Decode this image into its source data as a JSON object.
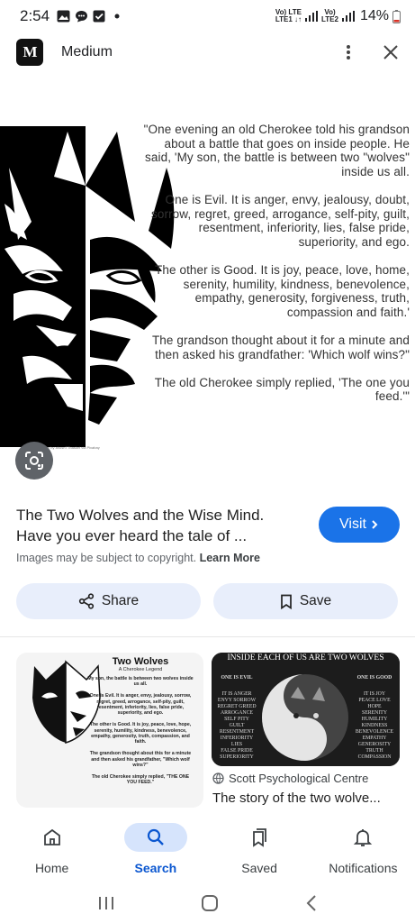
{
  "status_bar": {
    "time": "2:54",
    "net1": "Vo) LTE\nLTE1 ↓↑",
    "net2": "Vo)\nLTE2",
    "battery": "14%"
  },
  "top_bar": {
    "logo_text": "M",
    "site_name": "Medium"
  },
  "hero": {
    "quote": "\"One evening an old Cherokee told his grandson about a battle that goes on inside people. He said, 'My son, the battle is between two \"wolves\" inside us all.\n\nOne is Evil. It is anger, envy, jealousy, doubt, sorrow, regret, greed, arrogance, self-pity, guilt, resentment, inferiority, lies, false pride, superiority, and ego.\n\nThe other is Good. It is joy, peace, love, home, serenity, humility, kindness, benevolence, empathy, generosity, forgiveness, truth, compassion and faith.'\n\nThe grandson thought about it for a minute and then asked his grandfather: 'Which wolf wins?\"\n\nThe old Cherokee simply replied, 'The one you feed.'\"",
    "credit": "Image by ahusnTTbasket via Pixabay"
  },
  "result": {
    "title": "The Two Wolves and the Wise Mind. Have you ever heard the tale of ...",
    "visit_label": "Visit",
    "copyright_prefix": "Images may be subject to copyright.",
    "learn_more": "Learn More"
  },
  "actions": {
    "share": "Share",
    "save": "Save"
  },
  "related": {
    "left": {
      "title": "Two Wolves",
      "subtitle": "A Cherokee Legend",
      "body": "My son, the battle is between two wolves inside us all.\n\nOne is Evil. It is anger, envy, jealousy, sorrow, regret, greed, arrogance, self-pity, guilt, resentment, inferiority, lies, false pride, superiority, and ego.\n\nThe other is Good. It is joy, peace, love, hope, serenity, humility, kindness, benevolence, empathy, generosity, truth, compassion, and faith.\n\nThe grandson thought about this for a minute and then asked his grandfather, \"Which wolf wins?\"\n\nThe old Cherokee simply replied, \"THE ONE YOU FEED.\""
    },
    "right": {
      "header": "INSIDE EACH OF US ARE TWO WOLVES",
      "evil_title": "ONE IS EVIL",
      "evil_list": "IT IS ANGER\nENVY SORROW\nREGRET GREED\nARROGANCE\nSELF PITY\nGUILT\nRESENTMENT\nINFERIORITY\nLIES\nFALSE PRIDE\nSUPERIORITY",
      "good_title": "ONE IS GOOD",
      "good_list": "IT IS JOY\nPEACE LOVE\nHOPE\nSERENITY\nHUMILITY\nKINDNESS\nBENEVOLENCE\nEMPATHY\nGENEROSITY\nTRUTH\nCOMPASSION",
      "source": "Scott Psychological Centre",
      "title": "The story of the two wolve..."
    }
  },
  "bottom_nav": {
    "items": [
      {
        "label": "Home",
        "icon": "home-icon"
      },
      {
        "label": "Search",
        "icon": "search-icon",
        "active": true
      },
      {
        "label": "Saved",
        "icon": "bookmarks-icon"
      },
      {
        "label": "Notifications",
        "icon": "bell-icon"
      }
    ]
  },
  "colors": {
    "accent": "#1a73e8",
    "pill_bg": "#e8eefb",
    "active_nav": "#0b57d0"
  }
}
